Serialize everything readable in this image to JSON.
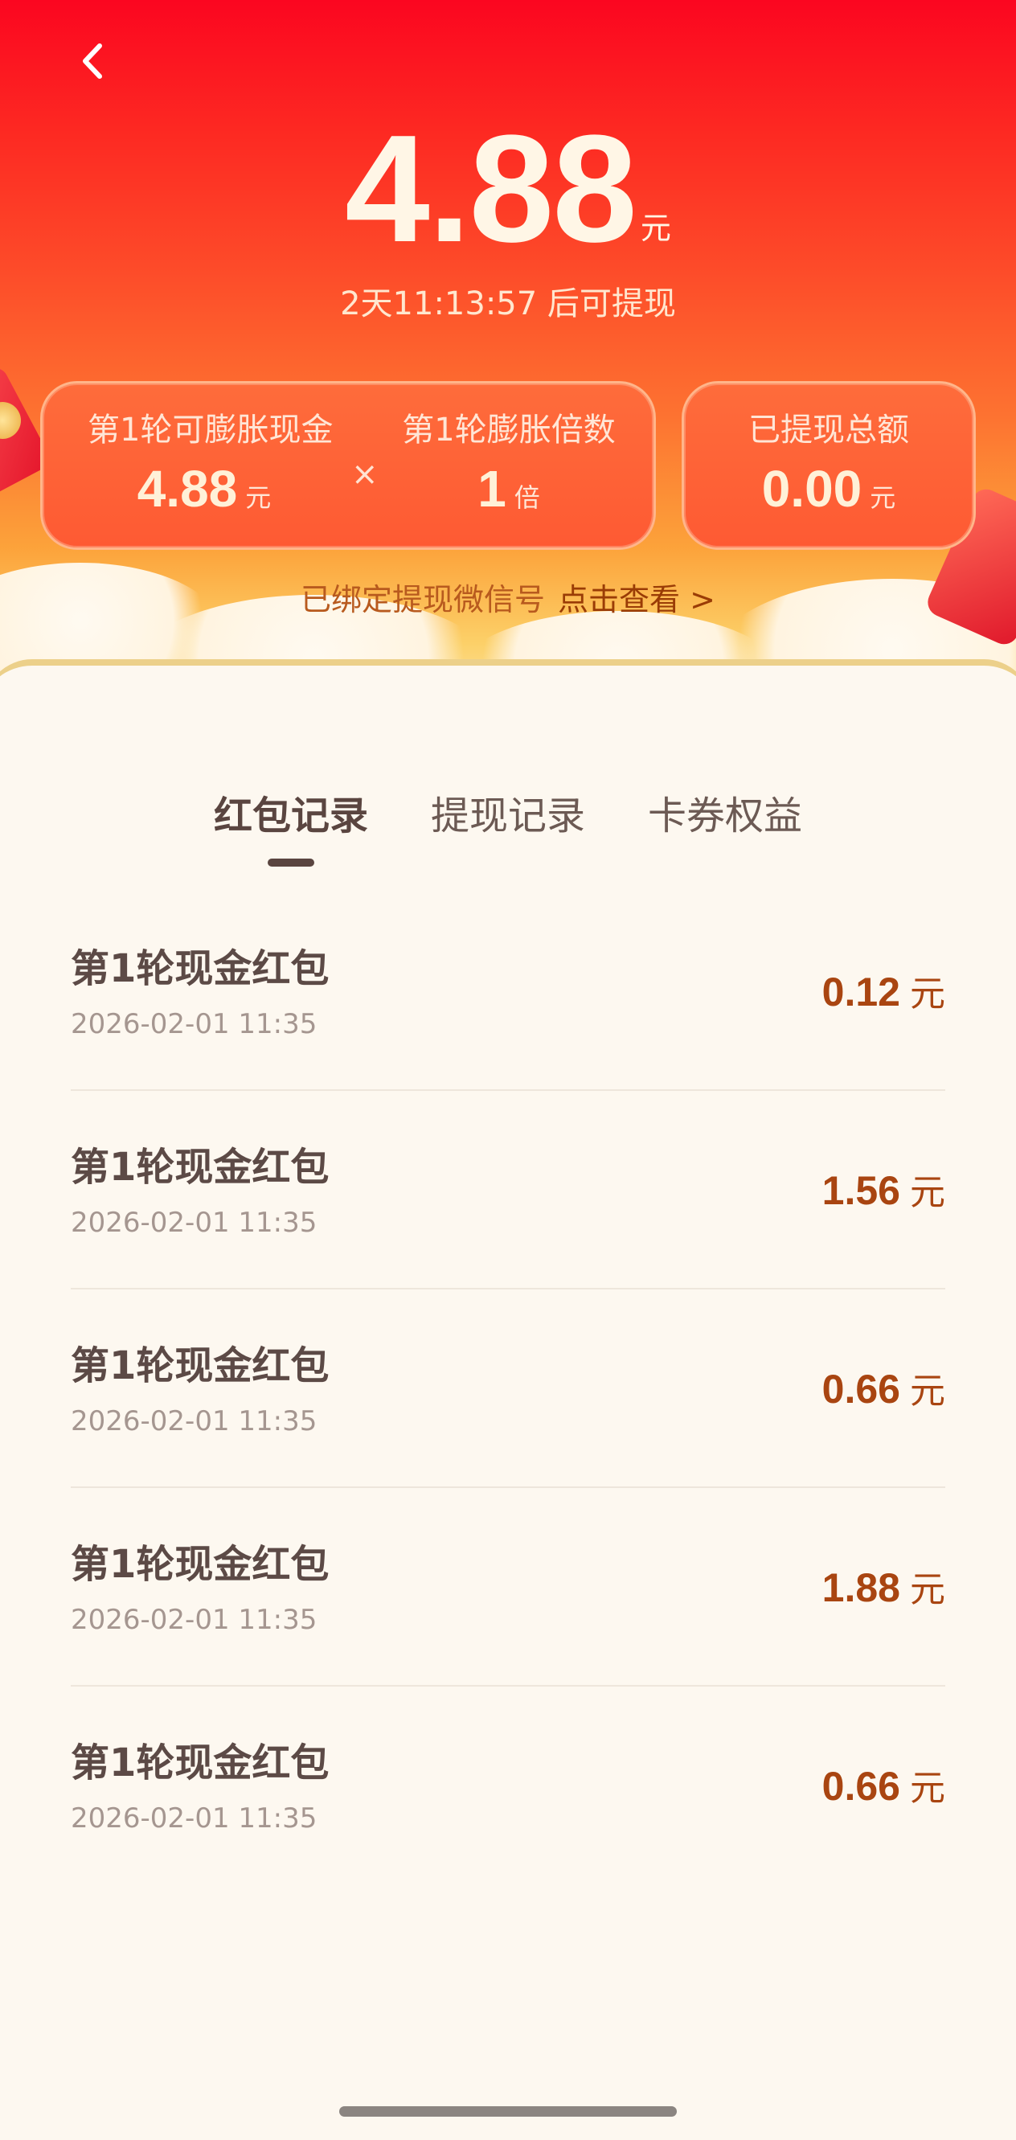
{
  "header": {
    "back_icon": "chevron-left-icon",
    "amount": "4.88",
    "amount_unit": "元",
    "countdown": "2天11:13:57 后可提现"
  },
  "cards": {
    "round_cash": {
      "label": "第1轮可膨胀现金",
      "value": "4.88",
      "unit": "元"
    },
    "operator": "×",
    "round_multiplier": {
      "label": "第1轮膨胀倍数",
      "value": "1",
      "unit": "倍"
    },
    "withdrawn_total": {
      "label": "已提现总额",
      "value": "0.00",
      "unit": "元"
    }
  },
  "wechat": {
    "text": "已绑定提现微信号",
    "cta": "点击查看 >"
  },
  "tabs": [
    {
      "label": "红包记录",
      "active": true
    },
    {
      "label": "提现记录",
      "active": false
    },
    {
      "label": "卡券权益",
      "active": false
    }
  ],
  "records": [
    {
      "title": "第1轮现金红包",
      "time": "2026-02-01 11:35",
      "amount": "0.12",
      "unit": "元"
    },
    {
      "title": "第1轮现金红包",
      "time": "2026-02-01 11:35",
      "amount": "1.56",
      "unit": "元"
    },
    {
      "title": "第1轮现金红包",
      "time": "2026-02-01 11:35",
      "amount": "0.66",
      "unit": "元"
    },
    {
      "title": "第1轮现金红包",
      "time": "2026-02-01 11:35",
      "amount": "1.88",
      "unit": "元"
    },
    {
      "title": "第1轮现金红包",
      "time": "2026-02-01 11:35",
      "amount": "0.66",
      "unit": "元"
    }
  ],
  "colors": {
    "header_red": "#fb0620",
    "card_orange": "#fe5a33",
    "amount_brown": "#a94511",
    "background": "#fdf8f0"
  }
}
